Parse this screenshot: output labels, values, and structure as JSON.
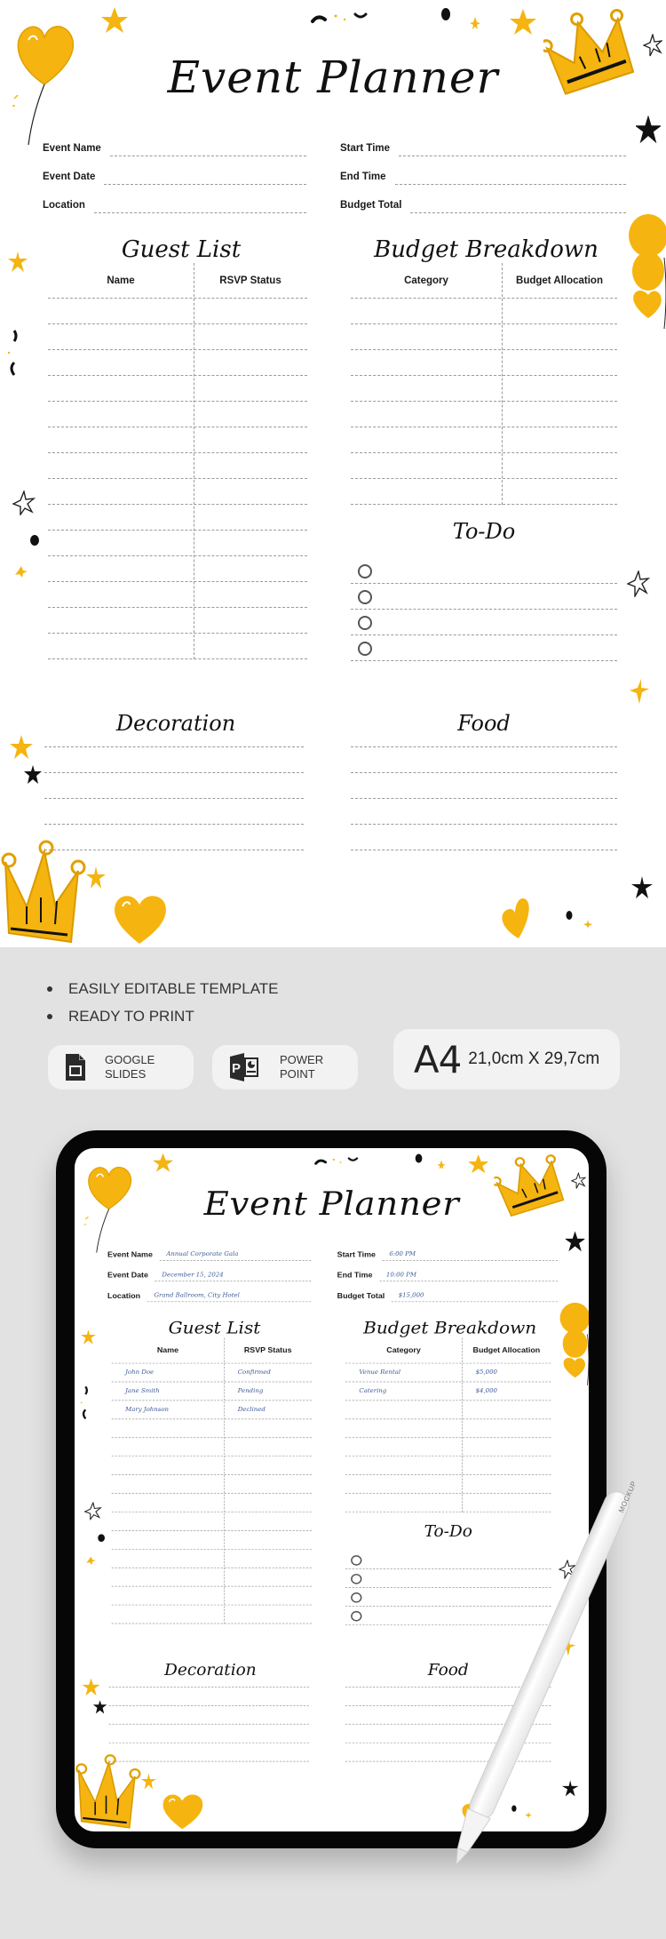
{
  "planner": {
    "title": "Event Planner",
    "fields_left": [
      {
        "label": "Event Name"
      },
      {
        "label": "Event Date"
      },
      {
        "label": "Location"
      }
    ],
    "fields_right": [
      {
        "label": "Start Time"
      },
      {
        "label": "End Time"
      },
      {
        "label": "Budget Total"
      }
    ],
    "guest_list": {
      "title": "Guest List",
      "columns": [
        "Name",
        "RSVP Status"
      ],
      "row_count": 14
    },
    "budget": {
      "title": "Budget Breakdown",
      "columns": [
        "Category",
        "Budget Allocation"
      ],
      "row_count": 8
    },
    "todo": {
      "title": "To-Do",
      "item_count": 4
    },
    "decoration": {
      "title": "Decoration",
      "line_count": 5
    },
    "food": {
      "title": "Food",
      "line_count": 5
    }
  },
  "filled_example": {
    "event_name": "Annual Corporate Gala",
    "event_date": "December 15, 2024",
    "location": "Grand Ballroom, City Hotel",
    "start_time": "6:00 PM",
    "end_time": "10:00 PM",
    "budget_total": "$15,000",
    "guests": [
      {
        "name": "John Doe",
        "rsvp": "Confirmed"
      },
      {
        "name": "Jane Smith",
        "rsvp": "Pending"
      },
      {
        "name": "Mary Johnson",
        "rsvp": "Declined"
      }
    ],
    "budget_items": [
      {
        "category": "Venue Rental",
        "allocation": "$5,000"
      },
      {
        "category": "Catering",
        "allocation": "$4,000"
      }
    ]
  },
  "features": [
    "EASILY EDITABLE TEMPLATE",
    "READY TO PRINT"
  ],
  "formats": [
    {
      "icon": "google-slides-icon",
      "line1": "GOOGLE",
      "line2": "SLIDES"
    },
    {
      "icon": "powerpoint-icon",
      "line1": "POWER",
      "line2": "POINT"
    }
  ],
  "paper_size": {
    "name": "A4",
    "dimensions": "21,0cm X 29,7cm"
  },
  "pencil_brand": "MOCKUP",
  "colors": {
    "accent_yellow": "#f5b40f",
    "ink": "#111111",
    "handwriting_blue": "#3a5896",
    "background_gray": "#e2e2e2",
    "badge_bg": "#f2f2f2"
  }
}
